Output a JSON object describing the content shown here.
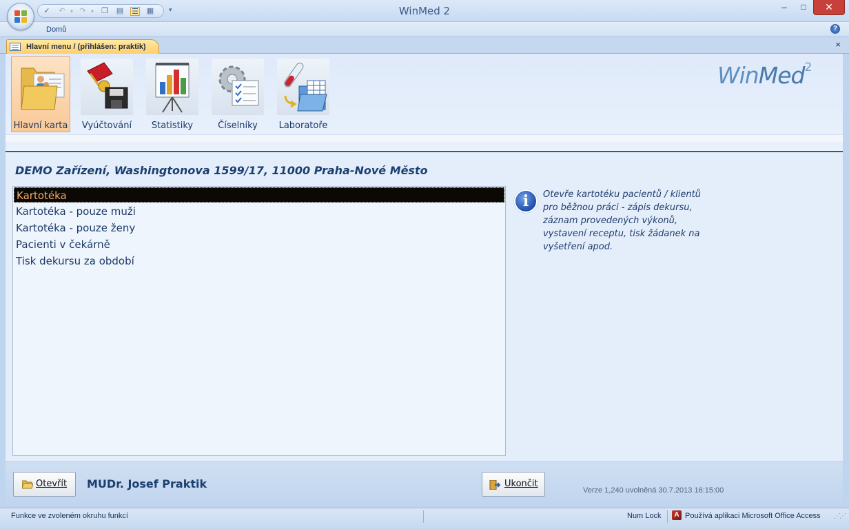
{
  "window": {
    "title": "WinMed 2",
    "min_glyph": "–",
    "max_glyph": "□",
    "close_glyph": "✕"
  },
  "quick_access": {
    "icons": [
      "spelling-icon",
      "undo-icon",
      "redo-icon",
      "copy-icon",
      "paste-icon",
      "form-view-icon",
      "datasheet-view-icon"
    ],
    "more_glyph": "▾"
  },
  "ribbon": {
    "tab_home": "Domů",
    "help_glyph": "?"
  },
  "doc_tab": {
    "label": "Hlavní menu / (přihlášen: praktik)",
    "close_glyph": "×"
  },
  "menu": {
    "items": [
      {
        "label": "Hlavní karta",
        "icon": "folder-patients-icon",
        "active": true
      },
      {
        "label": "Vyúčtování",
        "icon": "billing-icon",
        "active": false
      },
      {
        "label": "Statistiky",
        "icon": "statistics-chart-icon",
        "active": false
      },
      {
        "label": "Číselníky",
        "icon": "codebook-icon",
        "active": false
      },
      {
        "label": "Laboratoře",
        "icon": "laboratory-icon",
        "active": false
      }
    ]
  },
  "logo": {
    "part1": "Win",
    "part2": "Med",
    "sup": "2"
  },
  "facility": "DEMO Zařízení, Washingtonova 1599/17, 11000 Praha-Nové Město",
  "list": {
    "items": [
      "Kartotéka",
      "Kartotéka - pouze muži",
      "Kartotéka - pouze ženy",
      "Pacienti v čekárně",
      "Tisk dekursu za období"
    ],
    "selected_index": 0
  },
  "info": {
    "icon_glyph": "i",
    "text": "Otevře kartotéku pacientů / klientů pro běžnou práci - zápis dekursu, záznam provedených výkonů, vystavení receptu, tisk žádanek na vyšetření apod."
  },
  "footer": {
    "open_button": "Otevřít",
    "doctor": "MUDr. Josef Praktik",
    "exit_button": "Ukončit",
    "version": "Verze 1,240 uvolněná 30.7.2013 16:15:00"
  },
  "status": {
    "left": "Funkce ve zvoleném okruhu funkcí",
    "numlock": "Num Lock",
    "access": "Používá aplikaci Microsoft Office Access"
  },
  "colors": {
    "accent": "#15428b",
    "selection_bg": "#0c0804",
    "selection_fg": "#f2ad6a",
    "tab_active": "#ffcf6b"
  }
}
